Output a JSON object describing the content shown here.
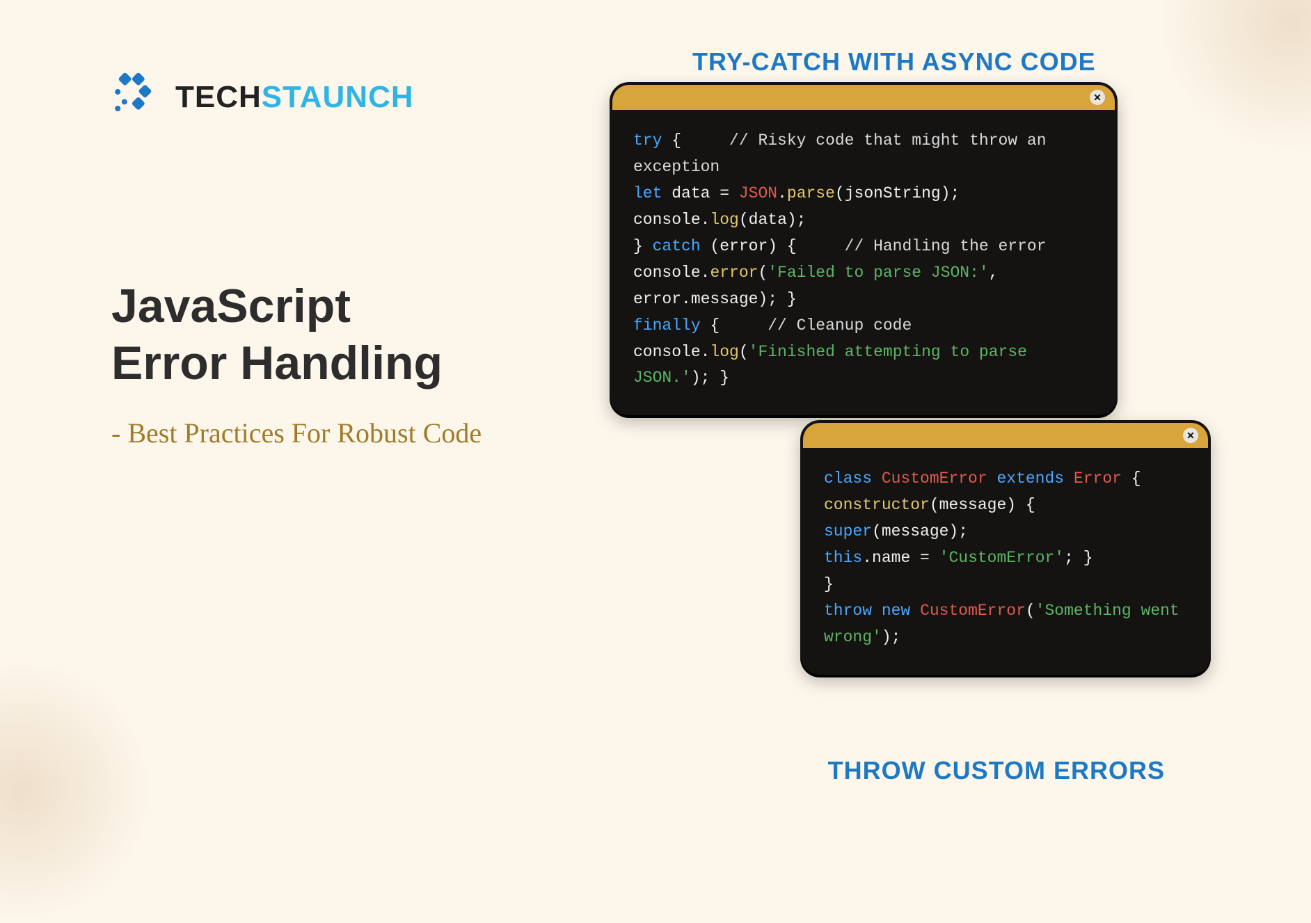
{
  "logo": {
    "part1": "TECH",
    "part2": "STAUNCH"
  },
  "headline": {
    "title_line1": "JavaScript",
    "title_line2": "Error Handling",
    "subtitle": "- Best Practices For Robust Code"
  },
  "sections": {
    "top": "Try-Catch With Async Code",
    "bottom": "Throw Custom Errors"
  },
  "panel_a": {
    "tokens": [
      [
        "kw",
        "try"
      ],
      [
        "pun",
        " {     "
      ],
      [
        "cmt",
        "// Risky code that might throw an exception"
      ],
      [
        "pun",
        "\n"
      ],
      [
        "kw",
        "let"
      ],
      [
        "id",
        " data "
      ],
      [
        "pun",
        "= "
      ],
      [
        "cls",
        "JSON"
      ],
      [
        "pun",
        "."
      ],
      [
        "fn",
        "parse"
      ],
      [
        "pun",
        "(jsonString);"
      ],
      [
        "pun",
        "\n"
      ],
      [
        "id",
        "console"
      ],
      [
        "pun",
        "."
      ],
      [
        "fn",
        "log"
      ],
      [
        "pun",
        "(data);"
      ],
      [
        "pun",
        "\n"
      ],
      [
        "pun",
        "} "
      ],
      [
        "kw",
        "catch"
      ],
      [
        "pun",
        " (error) {     "
      ],
      [
        "cmt",
        "// Handling the error"
      ],
      [
        "pun",
        "\n"
      ],
      [
        "id",
        "console"
      ],
      [
        "pun",
        "."
      ],
      [
        "fn",
        "error"
      ],
      [
        "pun",
        "("
      ],
      [
        "str",
        "'Failed to parse JSON:'"
      ],
      [
        "pun",
        ", error.message); }"
      ],
      [
        "pun",
        "\n"
      ],
      [
        "kw",
        "finally"
      ],
      [
        "pun",
        " {     "
      ],
      [
        "cmt",
        "// Cleanup code"
      ],
      [
        "pun",
        "\n"
      ],
      [
        "id",
        "console"
      ],
      [
        "pun",
        "."
      ],
      [
        "fn",
        "log"
      ],
      [
        "pun",
        "("
      ],
      [
        "str",
        "'Finished attempting to parse JSON.'"
      ],
      [
        "pun",
        "); }"
      ]
    ]
  },
  "panel_b": {
    "tokens": [
      [
        "kw",
        "class"
      ],
      [
        "pun",
        " "
      ],
      [
        "cls",
        "CustomError"
      ],
      [
        "pun",
        " "
      ],
      [
        "kw",
        "extends"
      ],
      [
        "pun",
        " "
      ],
      [
        "cls",
        "Error"
      ],
      [
        "pun",
        " {"
      ],
      [
        "pun",
        "\n"
      ],
      [
        "fn",
        "constructor"
      ],
      [
        "pun",
        "(message) {"
      ],
      [
        "pun",
        "\n"
      ],
      [
        "kw",
        "super"
      ],
      [
        "pun",
        "(message);"
      ],
      [
        "pun",
        "\n"
      ],
      [
        "kw",
        "this"
      ],
      [
        "pun",
        "."
      ],
      [
        "id",
        "name"
      ],
      [
        "pun",
        " = "
      ],
      [
        "str",
        "'CustomError'"
      ],
      [
        "pun",
        "; }"
      ],
      [
        "pun",
        "\n"
      ],
      [
        "pun",
        "}"
      ],
      [
        "pun",
        "\n"
      ],
      [
        "kw",
        "throw"
      ],
      [
        "pun",
        " "
      ],
      [
        "kw",
        "new"
      ],
      [
        "pun",
        " "
      ],
      [
        "cls",
        "CustomError"
      ],
      [
        "pun",
        "("
      ],
      [
        "str",
        "'Something went wrong'"
      ],
      [
        "pun",
        ");"
      ]
    ]
  }
}
